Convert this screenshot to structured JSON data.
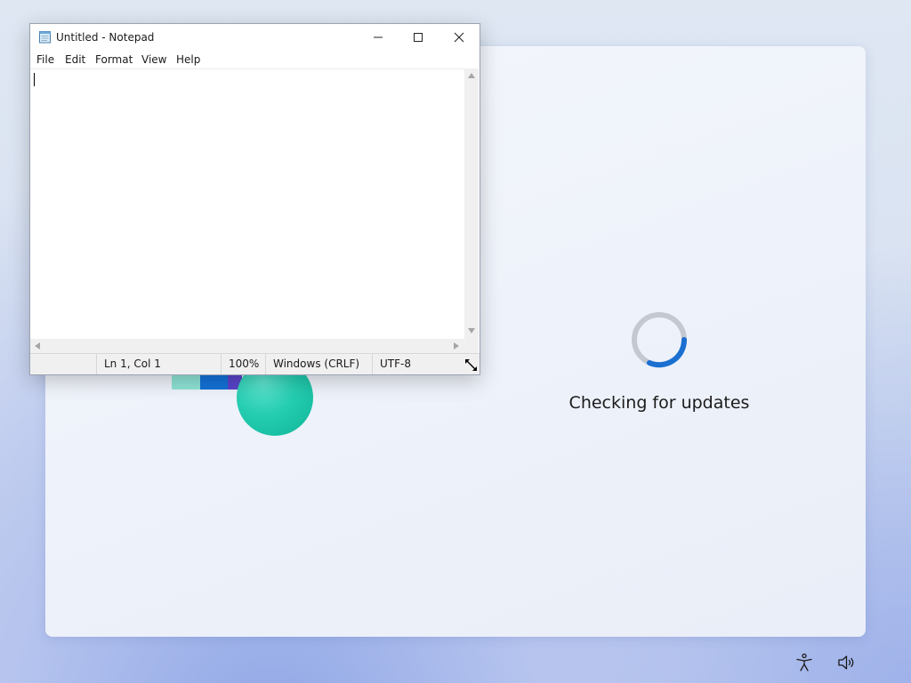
{
  "notepad": {
    "title": "Untitled - Notepad",
    "menu": [
      "File",
      "Edit",
      "Format",
      "View",
      "Help"
    ],
    "content": "",
    "status": {
      "position": "Ln 1, Col 1",
      "zoom": "100%",
      "line_ending": "Windows (CRLF)",
      "encoding": "UTF-8"
    }
  },
  "setup": {
    "status_text": "Checking for updates",
    "spinner_accent": "#1a6fd1"
  },
  "tray": {
    "icons": [
      "accessibility-icon",
      "volume-icon"
    ]
  }
}
